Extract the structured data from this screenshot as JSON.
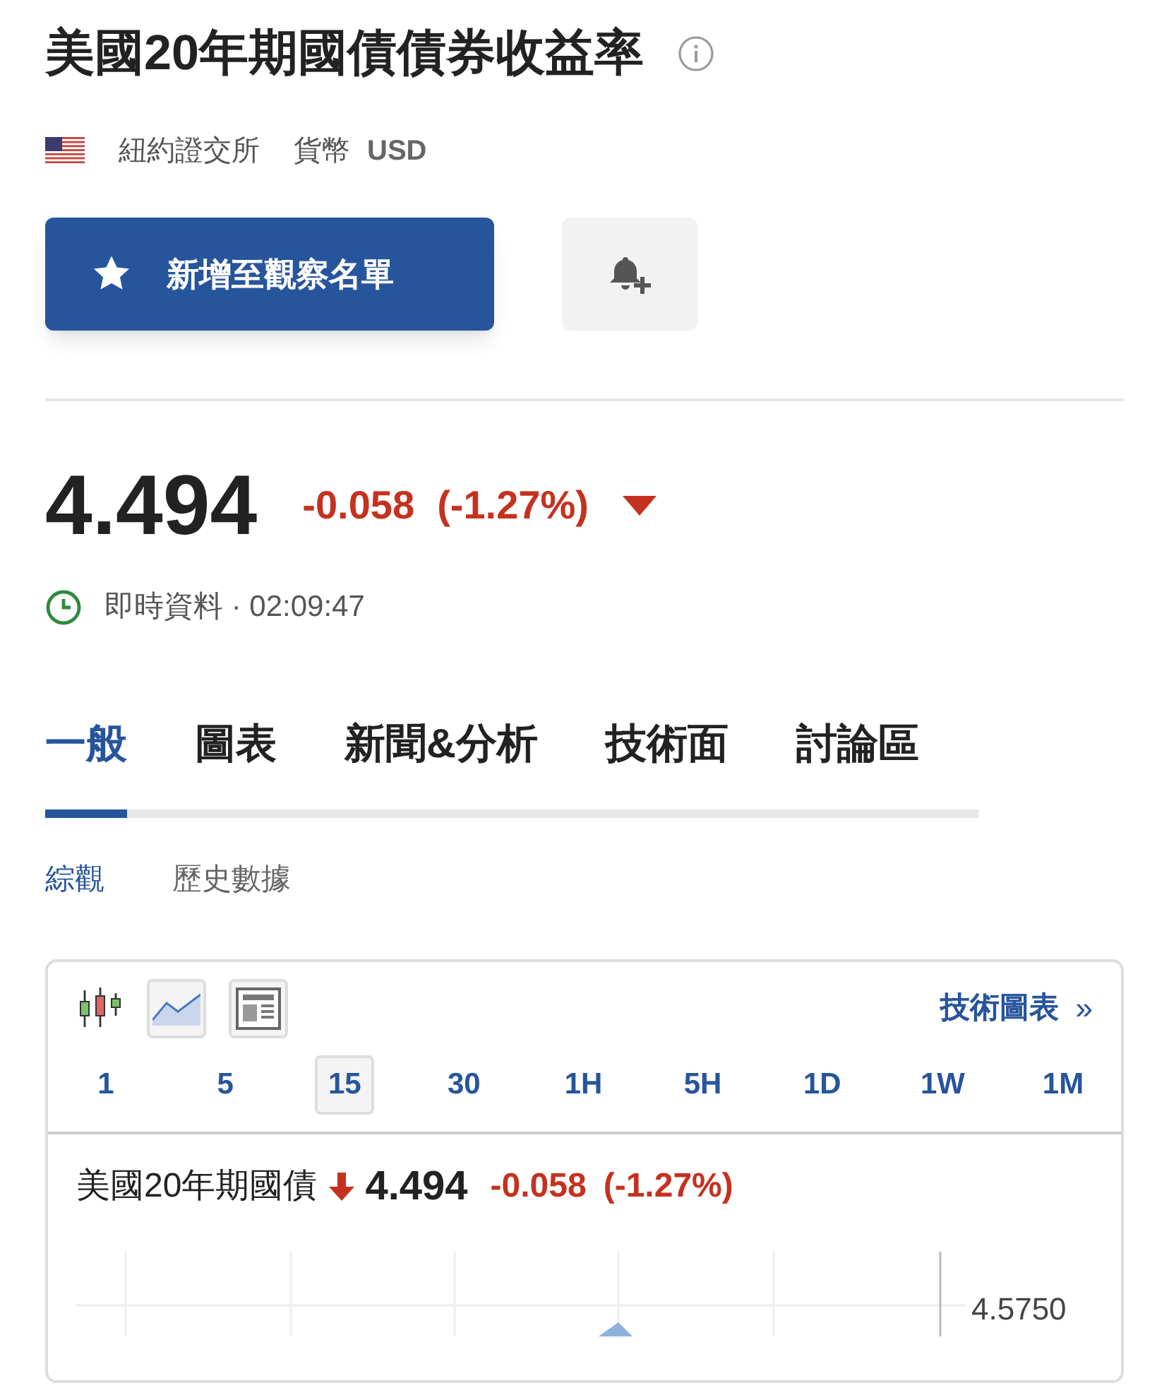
{
  "header": {
    "title": "美國20年期國債債券收益率",
    "exchange": "紐約證交所",
    "currency_label": "貨幣",
    "currency": "USD"
  },
  "actions": {
    "watchlist_button": "新增至觀察名單"
  },
  "quote": {
    "price": "4.494",
    "change": "-0.058",
    "change_percent": "(-1.27%)",
    "status": "即時資料 · 02:09:47"
  },
  "tabs": [
    {
      "label": "一般",
      "selected": true
    },
    {
      "label": "圖表",
      "selected": false
    },
    {
      "label": "新聞&分析",
      "selected": false
    },
    {
      "label": "技術面",
      "selected": false
    },
    {
      "label": "討論區",
      "selected": false
    }
  ],
  "subtabs": [
    {
      "label": "綜觀",
      "selected": true
    },
    {
      "label": "歷史數據",
      "selected": false
    }
  ],
  "chart_widget": {
    "link": "技術圖表",
    "link_arrow": "»",
    "intervals": [
      {
        "label": "1",
        "selected": false
      },
      {
        "label": "5",
        "selected": false
      },
      {
        "label": "15",
        "selected": true
      },
      {
        "label": "30",
        "selected": false
      },
      {
        "label": "1H",
        "selected": false
      },
      {
        "label": "5H",
        "selected": false
      },
      {
        "label": "1D",
        "selected": false
      },
      {
        "label": "1W",
        "selected": false
      },
      {
        "label": "1M",
        "selected": false
      }
    ],
    "name": "美國20年期國債",
    "price": "4.494",
    "change": "-0.058",
    "change_percent": "(-1.27%)",
    "axis_label": "4.5750"
  }
}
